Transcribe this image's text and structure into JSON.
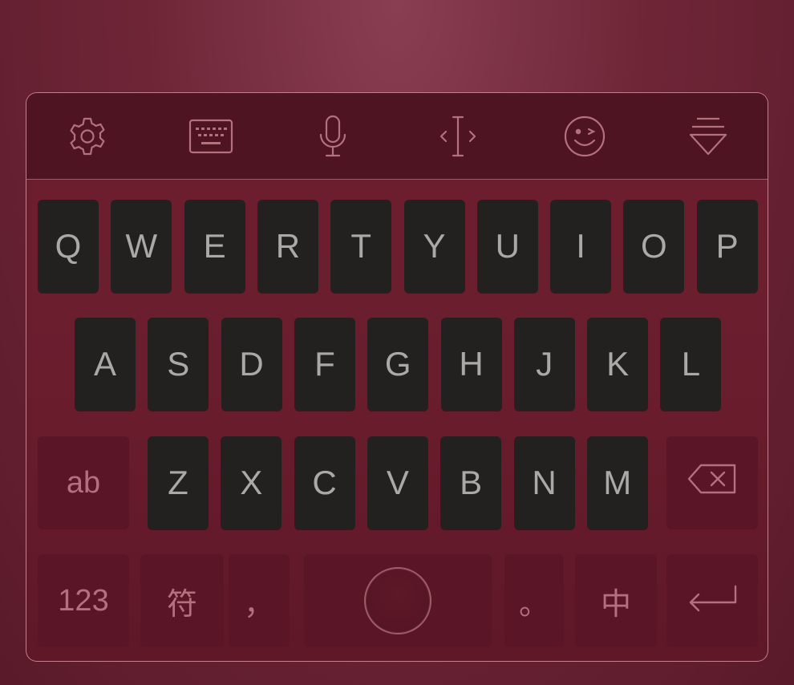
{
  "toolbar": {
    "icons": [
      "gear-icon",
      "keyboard-icon",
      "microphone-icon",
      "cursor-move-icon",
      "emoji-wink-icon",
      "collapse-keyboard-icon"
    ]
  },
  "rows": {
    "row1": [
      "Q",
      "W",
      "E",
      "R",
      "T",
      "Y",
      "U",
      "I",
      "O",
      "P"
    ],
    "row2": [
      "A",
      "S",
      "D",
      "F",
      "G",
      "H",
      "J",
      "K",
      "L"
    ],
    "row3": [
      "Z",
      "X",
      "C",
      "V",
      "B",
      "N",
      "M"
    ]
  },
  "keys": {
    "shift_label": "ab",
    "numbers_label": "123",
    "symbols_label": "符",
    "comma_label": "，",
    "period_label": "。",
    "language_label": "中"
  },
  "colors": {
    "letter_key_bg": "#232020",
    "function_key_bg": "#5a1526",
    "letter_text": "#a9a9a9",
    "function_text": "#b3707f"
  }
}
